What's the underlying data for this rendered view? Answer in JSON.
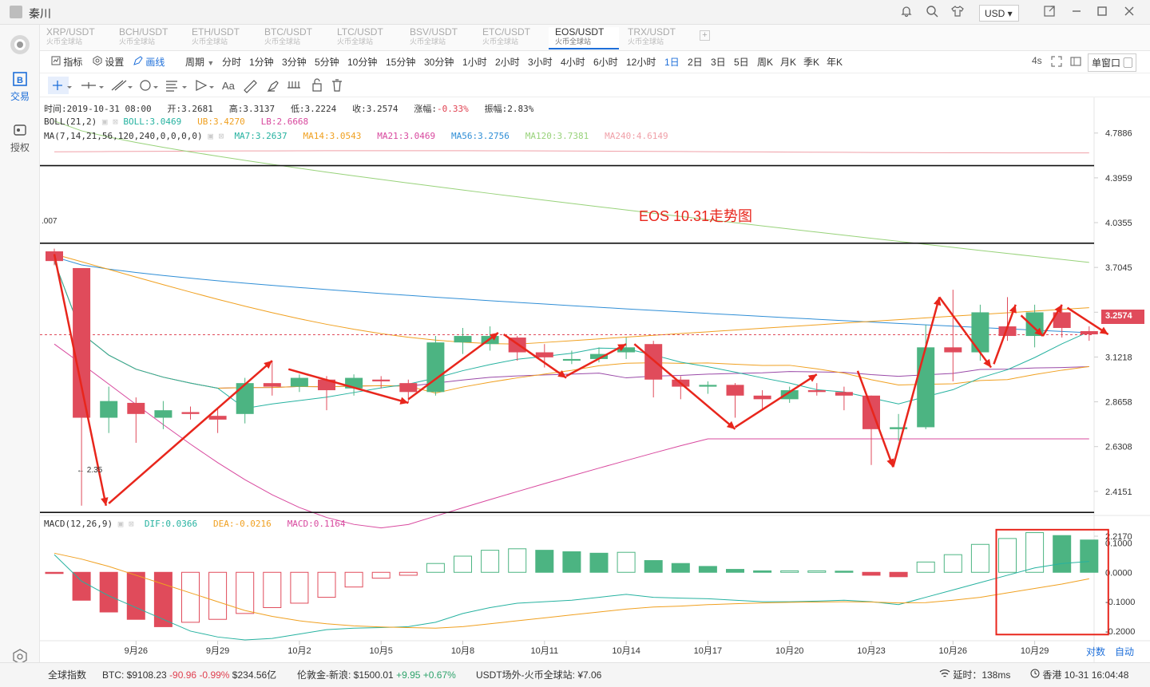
{
  "app": {
    "user_name": "秦川",
    "currency": "USD"
  },
  "tabs": [
    {
      "pair": "XRP/USDT",
      "exchange": "火币全球站",
      "active": false
    },
    {
      "pair": "BCH/USDT",
      "exchange": "火币全球站",
      "active": false
    },
    {
      "pair": "ETH/USDT",
      "exchange": "火币全球站",
      "active": false
    },
    {
      "pair": "BTC/USDT",
      "exchange": "火币全球站",
      "active": false
    },
    {
      "pair": "LTC/USDT",
      "exchange": "火币全球站",
      "active": false
    },
    {
      "pair": "BSV/USDT",
      "exchange": "火币全球站",
      "active": false
    },
    {
      "pair": "ETC/USDT",
      "exchange": "火币全球站",
      "active": false
    },
    {
      "pair": "EOS/USDT",
      "exchange": "火币全球站",
      "active": true
    },
    {
      "pair": "TRX/USDT",
      "exchange": "火币全球站",
      "active": false
    }
  ],
  "sidebar": {
    "trade": "交易",
    "authorize": "授权"
  },
  "toolbar": {
    "indicators": "指标",
    "settings": "设置",
    "draw": "画线",
    "period": "周期",
    "periods": [
      "分时",
      "1分钟",
      "3分钟",
      "5分钟",
      "10分钟",
      "15分钟",
      "30分钟",
      "1小时",
      "2小时",
      "3小时",
      "4小时",
      "6小时",
      "12小时",
      "1日",
      "2日",
      "3日",
      "5日",
      "周K",
      "月K",
      "季K",
      "年K"
    ],
    "active_period": "1日",
    "refresh": "4s",
    "window": "单窗口"
  },
  "candle_info": {
    "time": "时间:2019-10-31 08:00",
    "open": "开:3.2681",
    "high": "高:3.3137",
    "low": "低:3.2224",
    "close": "收:3.2574",
    "change_label": "涨幅:",
    "change": "-0.33%",
    "amp": "振幅:2.83%"
  },
  "boll": {
    "label": "BOLL(21,2)",
    "boll": "BOLL:3.0469",
    "ub": "UB:3.4270",
    "lb": "LB:2.6668"
  },
  "ma": {
    "label": "MA(7,14,21,56,120,240,0,0,0,0)",
    "ma7": "MA7:3.2637",
    "ma14": "MA14:3.0543",
    "ma21": "MA21:3.0469",
    "ma56": "MA56:3.2756",
    "ma120": "MA120:3.7381",
    "ma240": "MA240:4.6149"
  },
  "macd": {
    "label": "MACD(12,26,9)",
    "dif": "DIF:0.0366",
    "dea": "DEA:-0.0216",
    "macd": "MACD:0.1164"
  },
  "annotations": {
    "title": "EOS 10.31走势图",
    "max_label": ".007",
    "min_label": "← 2.35",
    "current_price": "3.2574"
  },
  "price_axis": [
    "4.7886",
    "4.3959",
    "4.0355",
    "3.7045",
    "3.4007",
    "3.1218",
    "2.8658",
    "2.6308",
    "2.4151",
    "2.2170"
  ],
  "macd_axis": [
    "0.1000",
    "0.0000",
    "-0.1000",
    "-0.2000"
  ],
  "date_axis": [
    "9月26",
    "9月29",
    "10月2",
    "10月5",
    "10月8",
    "10月11",
    "10月14",
    "10月17",
    "10月20",
    "10月23",
    "10月26",
    "10月29"
  ],
  "axis_mode": {
    "log": "对数",
    "auto": "自动"
  },
  "colors": {
    "up": "#4cb482",
    "down": "#e04b5b",
    "boll": "#26b2a0",
    "ub": "#f0a020",
    "lb": "#d8489e",
    "ma56": "#2f8ed6",
    "ma120": "#98d27a",
    "ma240": "#f0a0a8",
    "annotation": "#e8261c"
  },
  "chart_data": {
    "type": "candlestick",
    "scale": "log",
    "candles": [
      {
        "date": "9月22",
        "o": 3.82,
        "h": 3.84,
        "l": 3.72,
        "c": 3.75
      },
      {
        "date": "9月23",
        "o": 3.7,
        "h": 3.7,
        "l": 2.35,
        "c": 2.78
      },
      {
        "date": "9月24",
        "o": 2.78,
        "h": 2.95,
        "l": 2.7,
        "c": 2.87
      },
      {
        "date": "9月25",
        "o": 2.86,
        "h": 2.89,
        "l": 2.65,
        "c": 2.8
      },
      {
        "date": "9月26",
        "o": 2.78,
        "h": 2.87,
        "l": 2.72,
        "c": 2.82
      },
      {
        "date": "9月27",
        "o": 2.81,
        "h": 2.84,
        "l": 2.77,
        "c": 2.8
      },
      {
        "date": "9月28",
        "o": 2.79,
        "h": 2.83,
        "l": 2.7,
        "c": 2.77
      },
      {
        "date": "9月29",
        "o": 2.8,
        "h": 3.0,
        "l": 2.75,
        "c": 2.97
      },
      {
        "date": "9月30",
        "o": 2.97,
        "h": 3.1,
        "l": 2.9,
        "c": 2.95
      },
      {
        "date": "10月1",
        "o": 2.95,
        "h": 3.02,
        "l": 2.92,
        "c": 3.0
      },
      {
        "date": "10月2",
        "o": 2.99,
        "h": 3.01,
        "l": 2.82,
        "c": 2.93
      },
      {
        "date": "10月3",
        "o": 2.94,
        "h": 3.02,
        "l": 2.9,
        "c": 3.0
      },
      {
        "date": "10月4",
        "o": 2.99,
        "h": 3.01,
        "l": 2.94,
        "c": 2.98
      },
      {
        "date": "10月5",
        "o": 2.97,
        "h": 2.99,
        "l": 2.86,
        "c": 2.92
      },
      {
        "date": "10月6",
        "o": 2.92,
        "h": 3.25,
        "l": 2.9,
        "c": 3.21
      },
      {
        "date": "10月7",
        "o": 3.21,
        "h": 3.3,
        "l": 3.14,
        "c": 3.25
      },
      {
        "date": "10月8",
        "o": 3.2,
        "h": 3.31,
        "l": 3.16,
        "c": 3.25
      },
      {
        "date": "10月9",
        "o": 3.24,
        "h": 3.25,
        "l": 3.1,
        "c": 3.15
      },
      {
        "date": "10月10",
        "o": 3.15,
        "h": 3.2,
        "l": 3.06,
        "c": 3.12
      },
      {
        "date": "10月11",
        "o": 3.1,
        "h": 3.16,
        "l": 3.08,
        "c": 3.11
      },
      {
        "date": "10月12",
        "o": 3.11,
        "h": 3.18,
        "l": 3.09,
        "c": 3.14
      },
      {
        "date": "10月13",
        "o": 3.15,
        "h": 3.24,
        "l": 3.11,
        "c": 3.18
      },
      {
        "date": "10月14",
        "o": 3.2,
        "h": 3.22,
        "l": 2.89,
        "c": 2.99
      },
      {
        "date": "10月15",
        "o": 2.99,
        "h": 3.01,
        "l": 2.88,
        "c": 2.95
      },
      {
        "date": "10月16",
        "o": 2.95,
        "h": 2.98,
        "l": 2.91,
        "c": 2.96
      },
      {
        "date": "10月17",
        "o": 2.96,
        "h": 2.97,
        "l": 2.78,
        "c": 2.9
      },
      {
        "date": "10月18",
        "o": 2.9,
        "h": 2.93,
        "l": 2.82,
        "c": 2.88
      },
      {
        "date": "10月19",
        "o": 2.88,
        "h": 2.95,
        "l": 2.86,
        "c": 2.93
      },
      {
        "date": "10月20",
        "o": 2.93,
        "h": 2.97,
        "l": 2.9,
        "c": 2.92
      },
      {
        "date": "10月21",
        "o": 2.92,
        "h": 2.95,
        "l": 2.82,
        "c": 2.9
      },
      {
        "date": "10月22",
        "o": 2.9,
        "h": 2.9,
        "l": 2.54,
        "c": 2.72
      },
      {
        "date": "10月23",
        "o": 2.72,
        "h": 2.8,
        "l": 2.66,
        "c": 2.73
      },
      {
        "date": "10月24",
        "o": 2.73,
        "h": 3.32,
        "l": 2.72,
        "c": 3.18
      },
      {
        "date": "10月25",
        "o": 3.18,
        "h": 3.55,
        "l": 2.98,
        "c": 3.15
      },
      {
        "date": "10月26",
        "o": 3.15,
        "h": 3.45,
        "l": 3.1,
        "c": 3.4
      },
      {
        "date": "10月27",
        "o": 3.31,
        "h": 3.5,
        "l": 3.22,
        "c": 3.25
      },
      {
        "date": "10月28",
        "o": 3.25,
        "h": 3.45,
        "l": 3.18,
        "c": 3.4
      },
      {
        "date": "10月29",
        "o": 3.4,
        "h": 3.45,
        "l": 3.24,
        "c": 3.3
      },
      {
        "date": "10月30",
        "o": 3.28,
        "h": 3.31,
        "l": 3.22,
        "c": 3.26
      }
    ],
    "macd_hist": [
      -0.004,
      -0.095,
      -0.135,
      -0.16,
      -0.185,
      -0.17,
      -0.16,
      -0.14,
      -0.12,
      -0.105,
      -0.085,
      -0.05,
      -0.02,
      -0.01,
      0.03,
      0.055,
      0.075,
      0.08,
      0.075,
      0.07,
      0.065,
      0.068,
      0.04,
      0.03,
      0.02,
      0.01,
      0.005,
      0.005,
      0.005,
      0.004,
      -0.01,
      -0.015,
      0.035,
      0.06,
      0.095,
      0.115,
      0.135,
      0.125,
      0.11
    ],
    "dif": [
      0.06,
      -0.03,
      -0.08,
      -0.12,
      -0.16,
      -0.2,
      -0.22,
      -0.23,
      -0.225,
      -0.21,
      -0.195,
      -0.19,
      -0.188,
      -0.185,
      -0.17,
      -0.14,
      -0.12,
      -0.105,
      -0.1,
      -0.095,
      -0.085,
      -0.075,
      -0.085,
      -0.088,
      -0.09,
      -0.095,
      -0.1,
      -0.1,
      -0.098,
      -0.095,
      -0.1,
      -0.11,
      -0.085,
      -0.06,
      -0.035,
      -0.01,
      0.015,
      0.03,
      0.037
    ],
    "dea": [
      0.065,
      0.045,
      0.02,
      -0.01,
      -0.04,
      -0.07,
      -0.1,
      -0.13,
      -0.15,
      -0.165,
      -0.175,
      -0.182,
      -0.186,
      -0.188,
      -0.19,
      -0.185,
      -0.175,
      -0.165,
      -0.155,
      -0.145,
      -0.135,
      -0.125,
      -0.118,
      -0.115,
      -0.11,
      -0.107,
      -0.104,
      -0.102,
      -0.101,
      -0.1,
      -0.101,
      -0.104,
      -0.103,
      -0.095,
      -0.085,
      -0.07,
      -0.055,
      -0.04,
      -0.022
    ],
    "price_range": [
      2.217,
      4.95
    ],
    "macd_range": [
      -0.23,
      0.15
    ]
  }
}
